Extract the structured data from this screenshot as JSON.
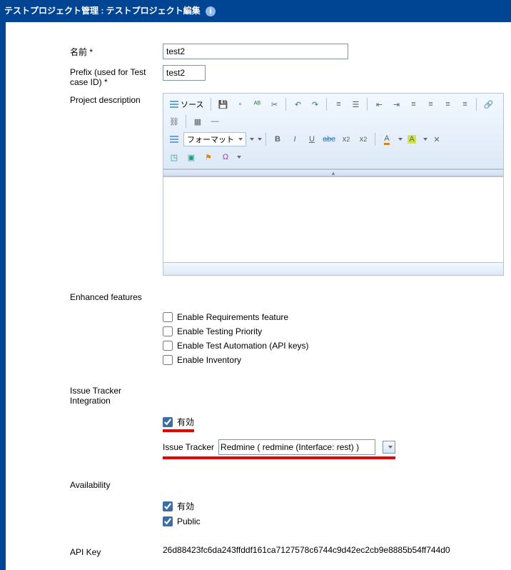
{
  "header": {
    "title": "テストプロジェクト管理 : テストプロジェクト編集"
  },
  "form": {
    "name_label": "名前 *",
    "name_value": "test2",
    "prefix_label": "Prefix (used for Test case ID) *",
    "prefix_value": "test2",
    "desc_label": "Project description"
  },
  "editor": {
    "source_label": "ソース",
    "format_label": "フォーマット"
  },
  "enhanced": {
    "heading": "Enhanced features",
    "requirements": "Enable Requirements feature",
    "priority": "Enable Testing Priority",
    "automation": "Enable Test Automation (API keys)",
    "inventory": "Enable Inventory"
  },
  "issue_tracker": {
    "heading": "Issue Tracker Integration",
    "enabled_label": "有効",
    "field_label": "Issue Tracker",
    "selected": "Redmine ( redmine (Interface: rest) )"
  },
  "availability": {
    "heading": "Availability",
    "enabled_label": "有効",
    "public_label": "Public"
  },
  "api": {
    "heading": "API Key",
    "value": "26d88423fc6da243ffddf161ca7127578c6744c9d42ec2cb9e8885b54ff744d0"
  }
}
